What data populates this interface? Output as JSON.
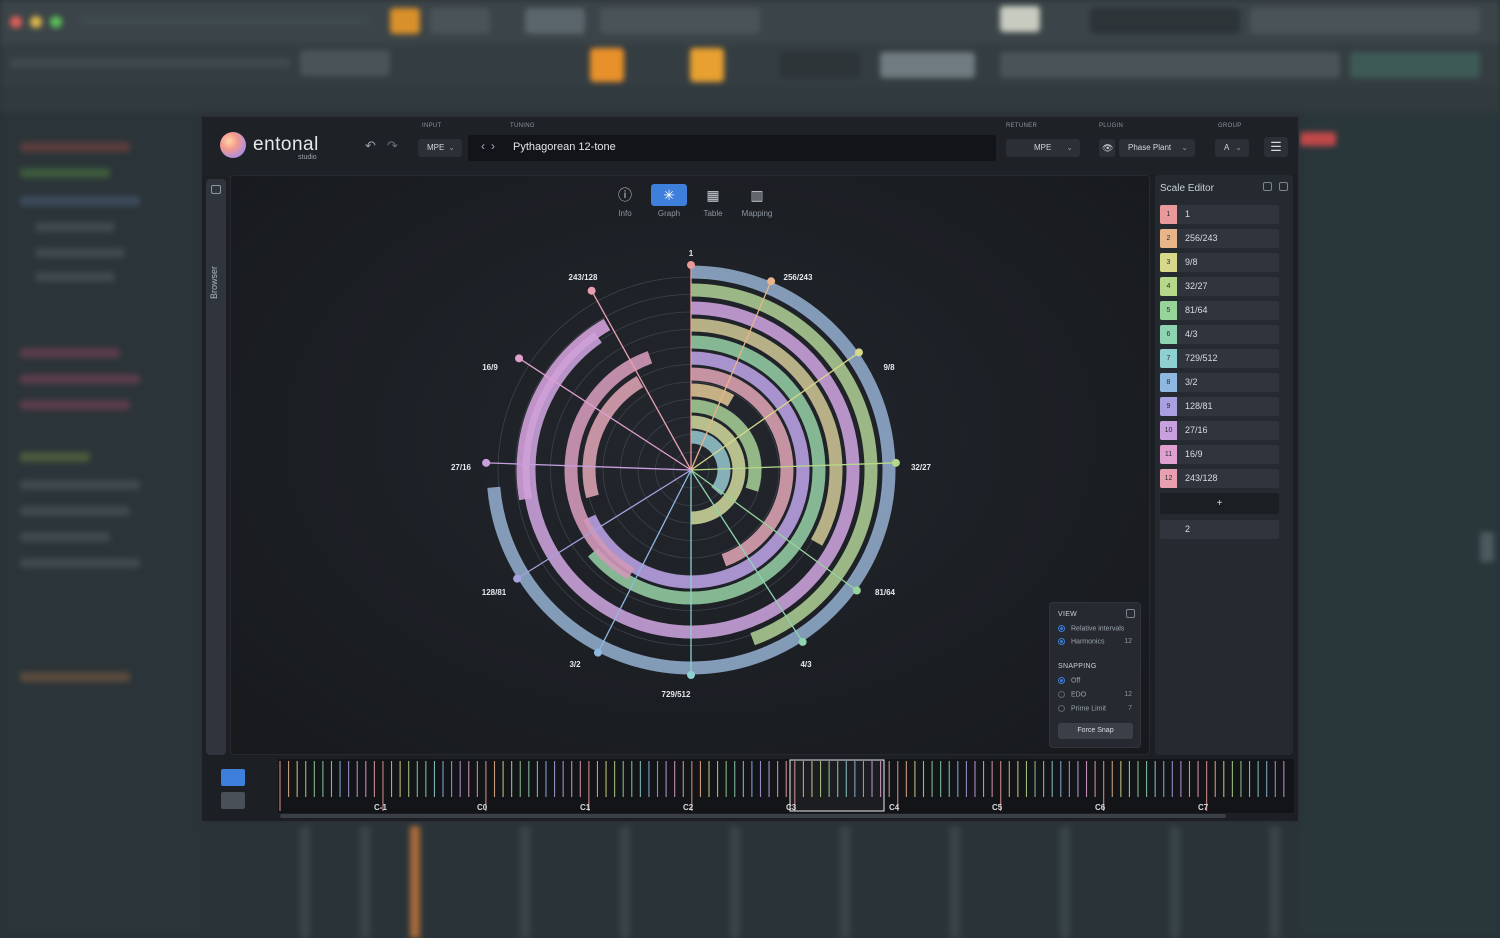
{
  "plugin": {
    "logo_text": "entonal",
    "logo_sub": "studio",
    "input_label": "INPUT",
    "input_value": "MPE",
    "tuning_label": "TUNING",
    "tuning_name": "Pythagorean 12-tone",
    "retuner_label": "RETUNER",
    "retuner_value": "MPE",
    "plugin_label": "PLUGIN",
    "plugin_value": "Phase Plant",
    "group_label": "GROUP",
    "group_value": "A",
    "undo_icon": "undo-icon",
    "redo_icon": "redo-icon",
    "menu_icon": "hamburger-menu-icon",
    "browser_label": "Browser"
  },
  "view_tabs": [
    {
      "label": "Info",
      "icon": "info-icon"
    },
    {
      "label": "Graph",
      "icon": "graph-icon"
    },
    {
      "label": "Table",
      "icon": "table-icon"
    },
    {
      "label": "Mapping",
      "icon": "piano-icon"
    }
  ],
  "active_view": "Graph",
  "graph": {
    "top_label": "1",
    "labels": [
      "256/243",
      "9/8",
      "32/27",
      "81/64",
      "4/3",
      "729/512",
      "3/2",
      "128/81",
      "27/16",
      "16/9",
      "243/128"
    ]
  },
  "view_panel": {
    "view_title": "VIEW",
    "relative_intervals": "Relative intervals",
    "harmonics": "Harmonics",
    "harmonics_value": "12",
    "snapping_title": "SNAPPING",
    "off": "Off",
    "edo": "EDO",
    "edo_value": "12",
    "prime_limit": "Prime Limit",
    "prime_limit_value": "7",
    "force_snap": "Force Snap"
  },
  "scale_editor": {
    "title": "Scale Editor",
    "rows": [
      {
        "num": "1",
        "ratio": "1",
        "color": "#e89a9a"
      },
      {
        "num": "2",
        "ratio": "256/243",
        "color": "#e8b48a"
      },
      {
        "num": "3",
        "ratio": "9/8",
        "color": "#d8d88a"
      },
      {
        "num": "4",
        "ratio": "32/27",
        "color": "#b6d88a"
      },
      {
        "num": "5",
        "ratio": "81/64",
        "color": "#96d49a"
      },
      {
        "num": "6",
        "ratio": "4/3",
        "color": "#8ed4b0"
      },
      {
        "num": "7",
        "ratio": "729/512",
        "color": "#8ed0d0"
      },
      {
        "num": "8",
        "ratio": "3/2",
        "color": "#8eb8e0"
      },
      {
        "num": "9",
        "ratio": "128/81",
        "color": "#a8a0e0"
      },
      {
        "num": "10",
        "ratio": "27/16",
        "color": "#c8a0e0"
      },
      {
        "num": "11",
        "ratio": "16/9",
        "color": "#e0a0d0"
      },
      {
        "num": "12",
        "ratio": "243/128",
        "color": "#e8a0b0"
      }
    ],
    "add_label": "+",
    "period": "2"
  },
  "keyboard": {
    "octaves": [
      "C-1",
      "C0",
      "C1",
      "C2",
      "C3",
      "C4",
      "C5",
      "C6",
      "C7"
    ]
  }
}
